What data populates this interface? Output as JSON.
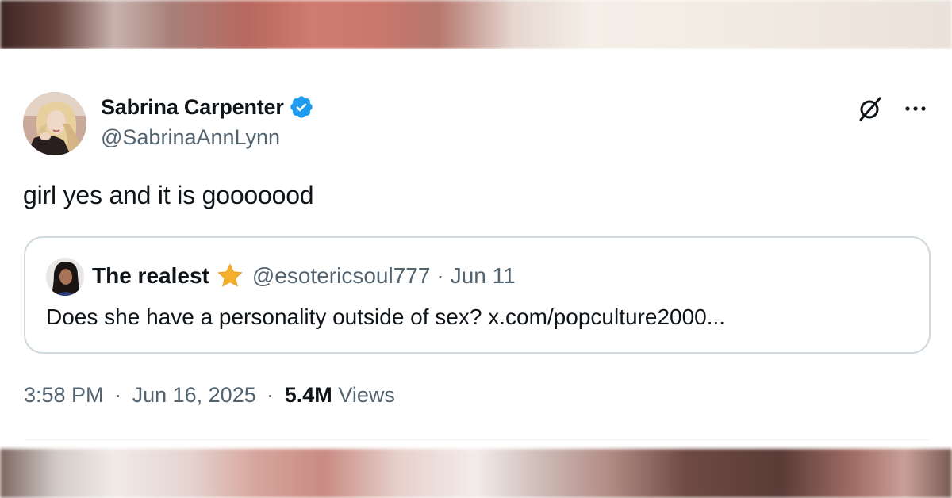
{
  "tweet": {
    "author": {
      "display_name": "Sabrina Carpenter",
      "handle": "@SabrinaAnnLynn",
      "verified_icon": "verified-badge-icon",
      "avatar": "profile-photo"
    },
    "text": "girl yes and it is gooooood",
    "actions": {
      "grok_icon": "grok-icon",
      "more_icon": "more-options-icon"
    },
    "quoted": {
      "display_name": "The realest",
      "emoji": "star-icon",
      "handle": "@esotericsoul777",
      "separator": "·",
      "date": "Jun 11",
      "text": "Does she have a personality outside of sex? x.com/popculture2000..."
    },
    "meta": {
      "time": "3:58 PM",
      "separator": "·",
      "date": "Jun 16, 2025",
      "views_count": "5.4M",
      "views_label": "Views"
    }
  },
  "colors": {
    "primary_text": "#0f1419",
    "secondary_text": "#536471",
    "verified_blue": "#1d9bf0",
    "border": "#cfd9de",
    "star": "#f4b02a"
  }
}
